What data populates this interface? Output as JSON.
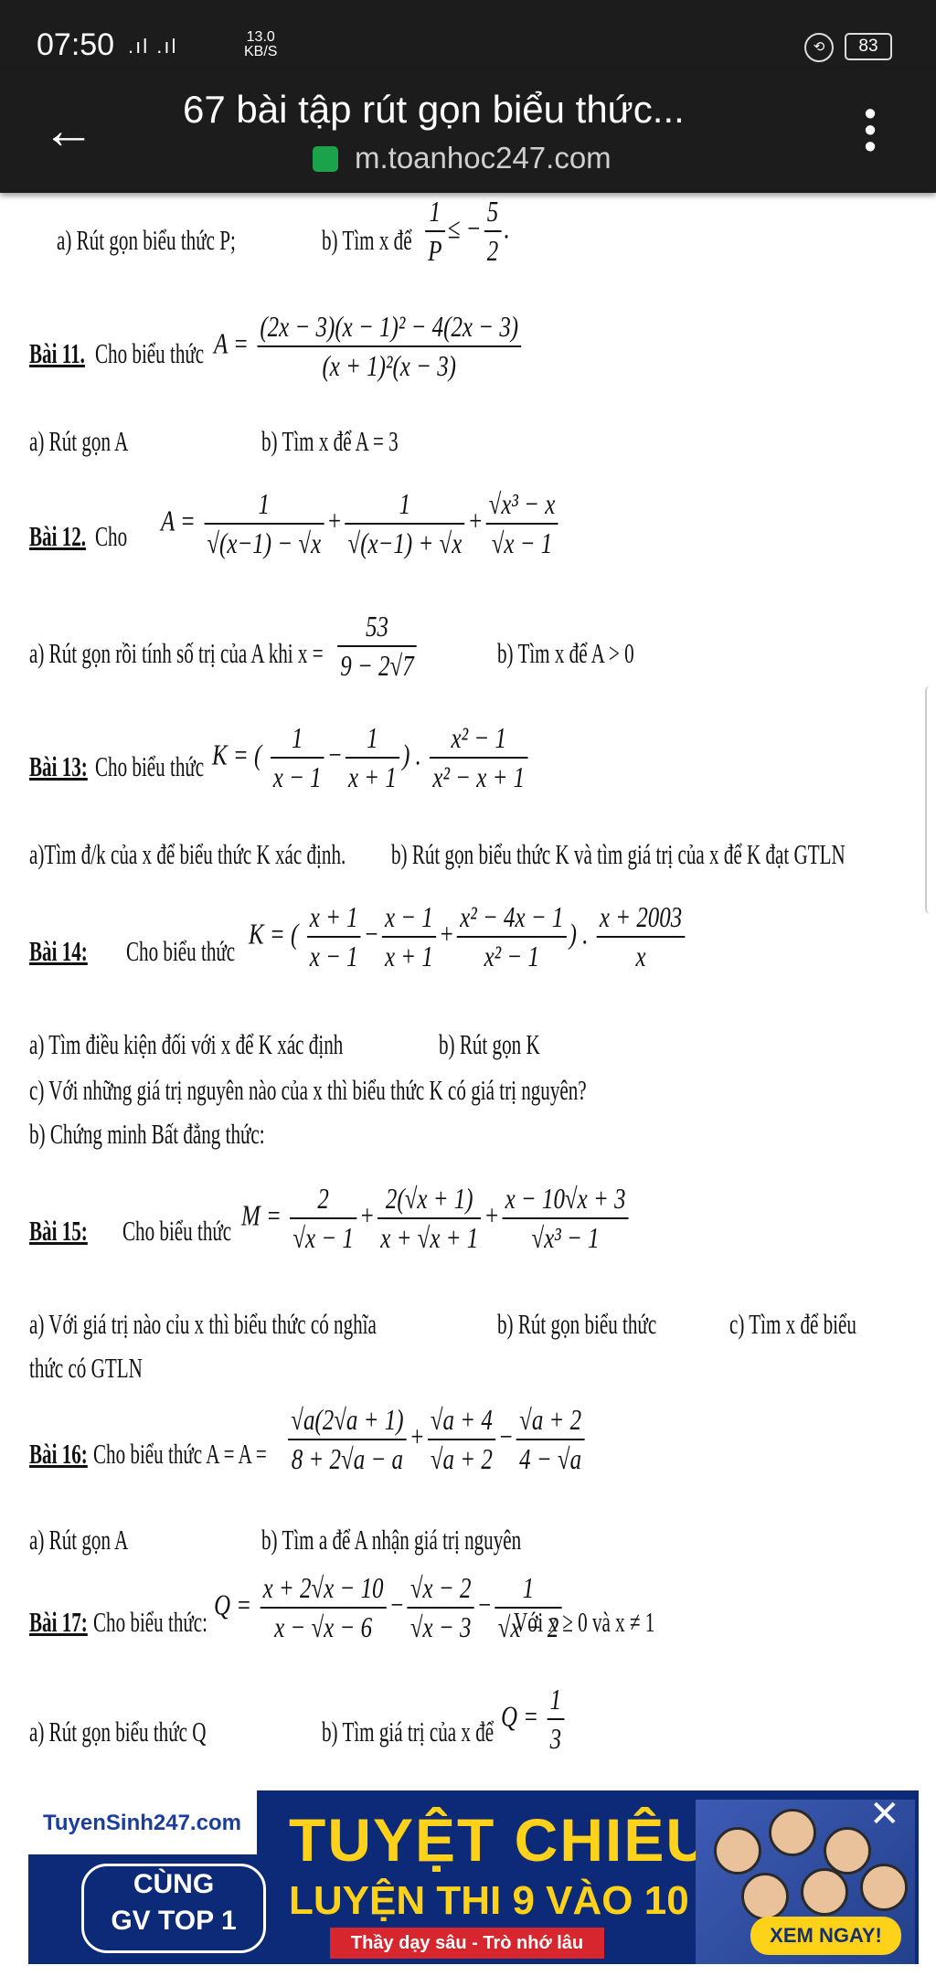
{
  "status_bar": {
    "time": "07:50",
    "signal": ".ıl .ıl",
    "speed_value": "13.0",
    "speed_unit": "KB/S",
    "battery": "83"
  },
  "browser": {
    "title": "67 bài tập rút gọn biểu thức...",
    "url": "m.toanhoc247.com"
  },
  "content": {
    "l0a": "a)  Rút gọn biểu thức P;",
    "l0b": "b) Tìm x để",
    "b11_h": "Bài 11.",
    "b11_t": "Cho biểu thức",
    "b11_f_num": "(2x − 3)(x − 1)² − 4(2x − 3)",
    "b11_f_den": "(x + 1)²(x − 3)",
    "b11_a": "a) Rút gọn A",
    "b11_b": "b) Tìm x để A = 3",
    "b12_h": "Bài 12.",
    "b12_t": "Cho",
    "b12_a": "a) Rút gọn rồi tính số trị của A khi x =",
    "b12_x_num": "53",
    "b12_x_den": "9 − 2√7",
    "b12_b": "b) Tìm x để A > 0",
    "b13_h": "Bài 13:",
    "b13_t": "Cho biểu thức",
    "b13_a": "a)Tìm đ/k của x để biểu thức K xác định.",
    "b13_b": "b) Rút gọn biểu thức K và tìm giá trị của x để K đạt GTLN",
    "b14_h": "Bài 14:",
    "b14_t": "Cho biểu thức",
    "b14_a": "a) Tìm điều kiện đối với x để K xác định",
    "b14_b": "b) Rút gọn K",
    "b14_c": "c) Với những giá trị nguyên nào của x thì biểu thức K có giá trị nguyên?",
    "b14_d": "b) Chứng minh Bất đẳng thức:",
    "b15_h": "Bài 15:",
    "b15_t": "Cho biểu thức",
    "b15_a": "a) Với giá trị nào cỉu x thì biểu thức có nghĩa",
    "b15_b": "b) Rút gọn biểu thức",
    "b15_c": "c) Tìm x để biểu",
    "b15_d": "thức có GTLN",
    "b16_h": "Bài 16:",
    "b16_t": "Cho biểu  thức A = A =",
    "b16_a": "a) Rút gọn A",
    "b16_b": "b) Tìm a để A nhận giá trị nguyên",
    "b17_h": "Bài 17:",
    "b17_t": "Cho biểu thức:",
    "b17_cond": "Với x ≥ 0 và x ≠ 1",
    "b17_a": "a) Rút gọn biểu thức Q",
    "b17_b": "b) Tìm giá trị của x để"
  },
  "ad": {
    "logo": "TuyenSinh247.com",
    "cung": "CÙNG",
    "gv": "GV TOP 1",
    "headline": "TUYỆT CHIÊU",
    "subline": "LUYỆN THI 9 VÀO 10",
    "slogan": "Thầy dạy sâu - Trò nhớ lâu",
    "cta": "XEM NGAY!"
  }
}
